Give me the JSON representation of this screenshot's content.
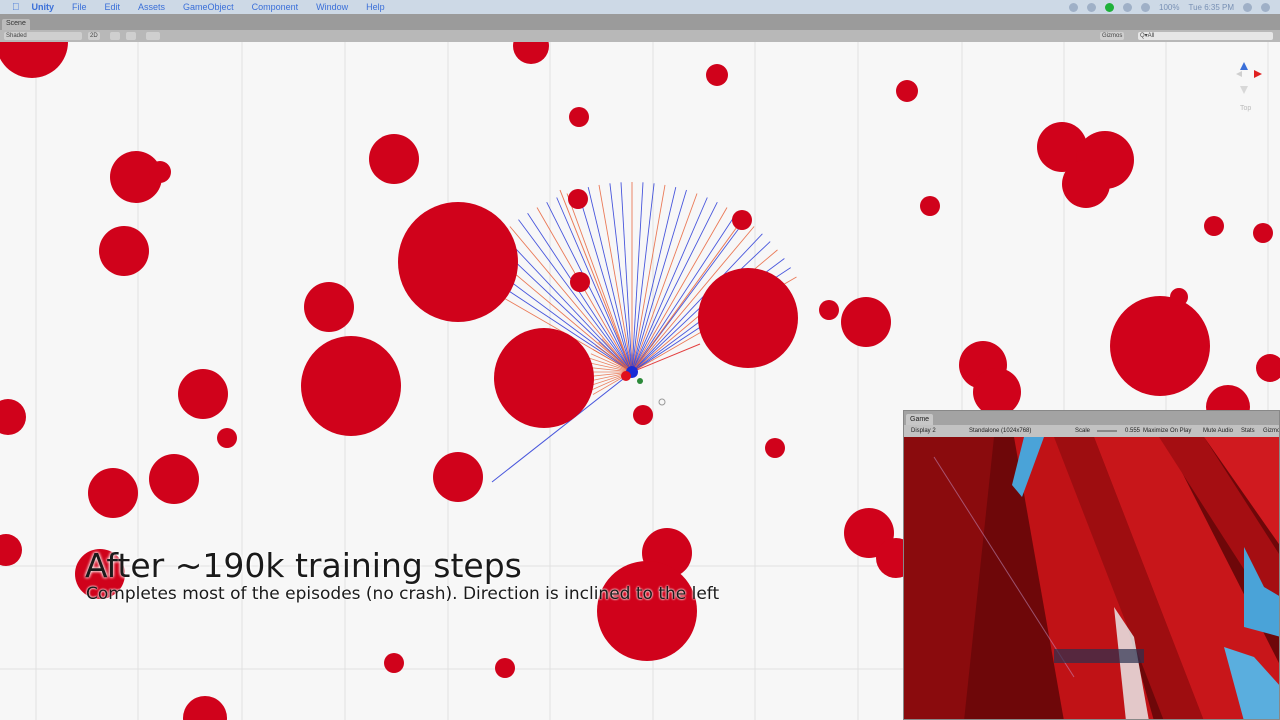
{
  "menubar": {
    "apple_icon": "apple-logo",
    "app_name": "Unity",
    "items": [
      "File",
      "Edit",
      "Assets",
      "GameObject",
      "Component",
      "Window",
      "Help"
    ],
    "battery": "100%",
    "clock": "Tue 6:35 PM"
  },
  "scene_window": {
    "tab_label": "Scene",
    "shading_mode": "Shaded",
    "mode_2d": "2D",
    "gizmos_label": "Gizmos",
    "search_placeholder": "Q▾All",
    "gizmo_view_label": "Top"
  },
  "game_window": {
    "tab_label": "Game",
    "display": "Display 2",
    "resolution": "Standalone (1024x768)",
    "scale_label": "Scale",
    "scale_value": "0.555",
    "maximize_on_play": "Maximize On Play",
    "mute_audio": "Mute Audio",
    "stats": "Stats",
    "gizmos": "Gizmos"
  },
  "caption": {
    "title": "After ~190k training steps",
    "subtitle": "Completes most of the episodes (no crash). Direction is inclined to the left"
  },
  "colors": {
    "obstacle_red": "#d0021b",
    "sensor_blue": "#2a3bd8",
    "sensor_orange": "#e8643c",
    "game_background": "#b80e12",
    "sky_blue": "#4aa3d8"
  }
}
